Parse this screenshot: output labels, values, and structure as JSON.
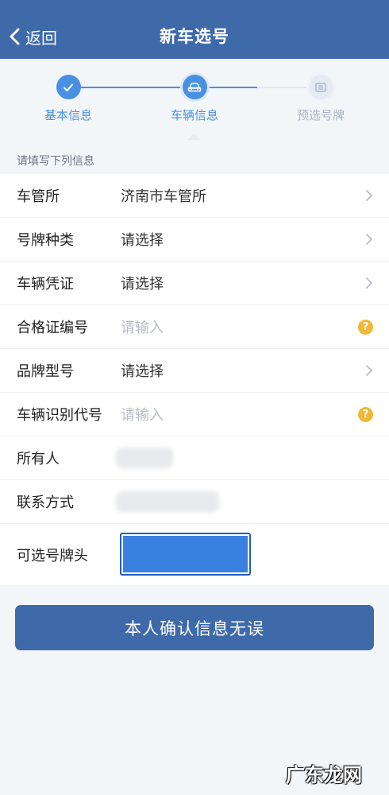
{
  "header": {
    "back_label": "返回",
    "title": "新车选号"
  },
  "stepper": {
    "steps": [
      {
        "label": "基本信息",
        "state": "done"
      },
      {
        "label": "车辆信息",
        "state": "active"
      },
      {
        "label": "预选号牌",
        "state": "todo"
      }
    ]
  },
  "form": {
    "hint": "请填写下列信息",
    "rows": [
      {
        "label": "车管所",
        "value": "济南市车管所"
      },
      {
        "label": "号牌种类",
        "value": "请选择"
      },
      {
        "label": "车辆凭证",
        "value": "请选择"
      },
      {
        "label": "合格证编号",
        "placeholder": "请输入"
      },
      {
        "label": "品牌型号",
        "value": "请选择"
      },
      {
        "label": "车辆识别代号",
        "placeholder": "请输入"
      },
      {
        "label": "所有人"
      },
      {
        "label": "联系方式"
      },
      {
        "label": "可选号牌头"
      }
    ]
  },
  "confirm_label": "本人确认信息无误",
  "watermark": "广东龙网",
  "colors": {
    "header": "#3f6aaa",
    "accent": "#4a90e2",
    "help": "#f2b733",
    "plate": "#3a80e0"
  }
}
